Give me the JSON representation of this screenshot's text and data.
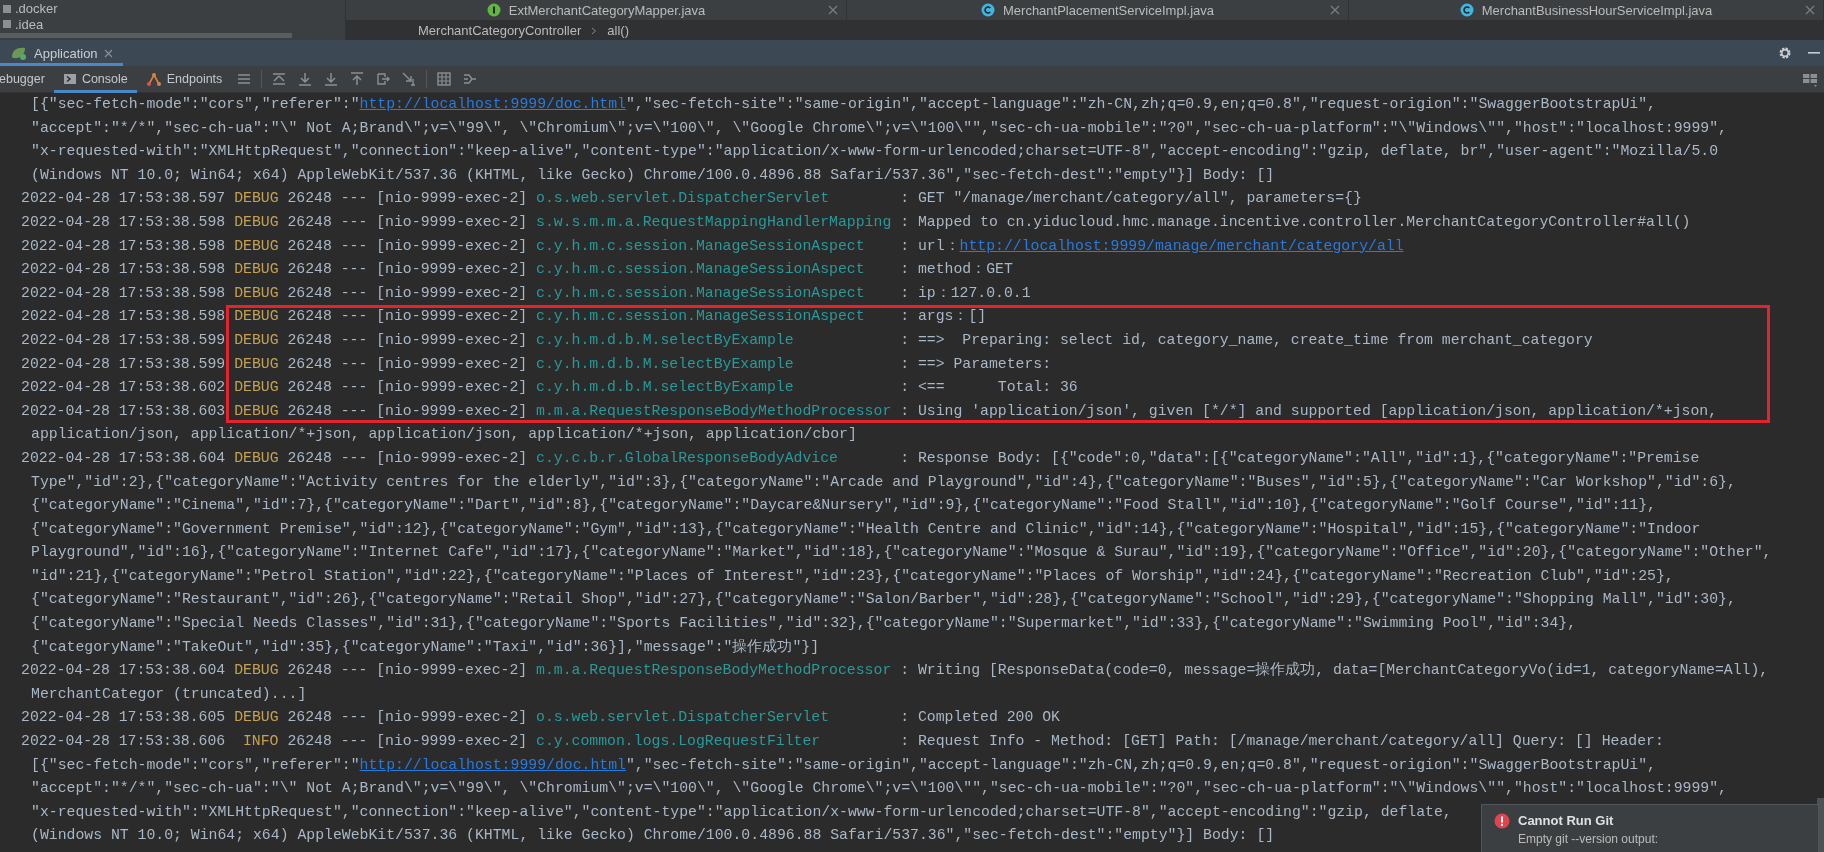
{
  "project_tree": {
    "items": [
      {
        "label": ".docker"
      },
      {
        "label": ".idea"
      }
    ]
  },
  "editor_tabs": [
    {
      "label": "ExtMerchantCategoryMapper.java",
      "kind": "interface"
    },
    {
      "label": "MerchantPlacementServiceImpl.java",
      "kind": "class"
    },
    {
      "label": "MerchantBusinessHourServiceImpl.java",
      "kind": "class"
    }
  ],
  "breadcrumbs": [
    "MerchantCategoryController",
    "all()"
  ],
  "run_window": {
    "tabs": [
      {
        "label": "Application",
        "selected": true
      }
    ]
  },
  "toolbar_tabs": [
    {
      "label": "ebugger",
      "kind": "plain",
      "selected": false
    },
    {
      "label": "Console",
      "kind": "console",
      "selected": true
    },
    {
      "label": "Endpoints",
      "kind": "endpoints",
      "selected": false
    }
  ],
  "console": {
    "lines": [
      {
        "kind": "wrap",
        "text": "[{\"sec-fetch-mode\":\"cors\",\"referer\":\"",
        "link": "http://localhost:9999/doc.html",
        "after": "\",\"sec-fetch-site\":\"same-origin\",\"accept-language\":\"zh-CN,zh;q=0.9,en;q=0.8\",\"request-origion\":\"SwaggerBootstrapUi\","
      },
      {
        "kind": "wrap",
        "text": "\"accept\":\"*/*\",\"sec-ch-ua\":\"\\\" Not A;Brand\\\";v=\\\"99\\\", \\\"Chromium\\\";v=\\\"100\\\", \\\"Google Chrome\\\";v=\\\"100\\\"\",\"sec-ch-ua-mobile\":\"?0\",\"sec-ch-ua-platform\":\"\\\"Windows\\\"\",\"host\":\"localhost:9999\","
      },
      {
        "kind": "wrap",
        "text": "\"x-requested-with\":\"XMLHttpRequest\",\"connection\":\"keep-alive\",\"content-type\":\"application/x-www-form-urlencoded;charset=UTF-8\",\"accept-encoding\":\"gzip, deflate, br\",\"user-agent\":\"Mozilla/5.0"
      },
      {
        "kind": "wrap",
        "text": "(Windows NT 10.0; Win64; x64) AppleWebKit/537.36 (KHTML, like Gecko) Chrome/100.0.4896.88 Safari/537.36\",\"sec-fetch-dest\":\"empty\"}] Body: []"
      },
      {
        "kind": "log",
        "time": "2022-04-28 17:53:38.597",
        "level": "DEBUG",
        "pid": "26248",
        "separator": "---",
        "thread": "[nio-9999-exec-2]",
        "logger": "o.s.web.servlet.DispatcherServlet",
        "message": ": GET \"/manage/merchant/category/all\", parameters={}"
      },
      {
        "kind": "log",
        "time": "2022-04-28 17:53:38.598",
        "level": "DEBUG",
        "pid": "26248",
        "separator": "---",
        "thread": "[nio-9999-exec-2]",
        "logger": "s.w.s.m.m.a.RequestMappingHandlerMapping",
        "message": ": Mapped to cn.yiducloud.hmc.manage.incentive.controller.MerchantCategoryController#all()"
      },
      {
        "kind": "log",
        "time": "2022-04-28 17:53:38.598",
        "level": "DEBUG",
        "pid": "26248",
        "separator": "---",
        "thread": "[nio-9999-exec-2]",
        "logger": "c.y.h.m.c.session.ManageSessionAspect",
        "message": ": url：",
        "link": "http://localhost:9999/manage/merchant/category/all"
      },
      {
        "kind": "log",
        "time": "2022-04-28 17:53:38.598",
        "level": "DEBUG",
        "pid": "26248",
        "separator": "---",
        "thread": "[nio-9999-exec-2]",
        "logger": "c.y.h.m.c.session.ManageSessionAspect",
        "message": ": method：GET"
      },
      {
        "kind": "log",
        "time": "2022-04-28 17:53:38.598",
        "level": "DEBUG",
        "pid": "26248",
        "separator": "---",
        "thread": "[nio-9999-exec-2]",
        "logger": "c.y.h.m.c.session.ManageSessionAspect",
        "message": ": ip：127.0.0.1"
      },
      {
        "kind": "log",
        "time": "2022-04-28 17:53:38.598",
        "level": "DEBUG",
        "pid": "26248",
        "separator": "---",
        "thread": "[nio-9999-exec-2]",
        "logger": "c.y.h.m.c.session.ManageSessionAspect",
        "message": ": args：[]"
      },
      {
        "kind": "log",
        "time": "2022-04-28 17:53:38.599",
        "level": "DEBUG",
        "pid": "26248",
        "separator": "---",
        "thread": "[nio-9999-exec-2]",
        "logger": "c.y.h.m.d.b.M.selectByExample",
        "message": ": ==>  Preparing: select id, category_name, create_time from merchant_category"
      },
      {
        "kind": "log",
        "time": "2022-04-28 17:53:38.599",
        "level": "DEBUG",
        "pid": "26248",
        "separator": "---",
        "thread": "[nio-9999-exec-2]",
        "logger": "c.y.h.m.d.b.M.selectByExample",
        "message": ": ==> Parameters: "
      },
      {
        "kind": "log",
        "time": "2022-04-28 17:53:38.602",
        "level": "DEBUG",
        "pid": "26248",
        "separator": "---",
        "thread": "[nio-9999-exec-2]",
        "logger": "c.y.h.m.d.b.M.selectByExample",
        "message": ": <==      Total: 36"
      },
      {
        "kind": "log",
        "time": "2022-04-28 17:53:38.603",
        "level": "DEBUG",
        "pid": "26248",
        "separator": "---",
        "thread": "[nio-9999-exec-2]",
        "logger": "m.m.a.RequestResponseBodyMethodProcessor",
        "message": ": Using 'application/json', given [*/*] and supported [application/json, application/*+json,"
      },
      {
        "kind": "wrap",
        "text": "application/json, application/*+json, application/json, application/*+json, application/cbor]"
      },
      {
        "kind": "log",
        "time": "2022-04-28 17:53:38.604",
        "level": "DEBUG",
        "pid": "26248",
        "separator": "---",
        "thread": "[nio-9999-exec-2]",
        "logger": "c.y.c.b.r.GlobalResponseBodyAdvice",
        "message": ": Response Body: [{\"code\":0,\"data\":[{\"categoryName\":\"All\",\"id\":1},{\"categoryName\":\"Premise"
      },
      {
        "kind": "wrap",
        "text": "Type\",\"id\":2},{\"categoryName\":\"Activity centres for the elderly\",\"id\":3},{\"categoryName\":\"Arcade and Playground\",\"id\":4},{\"categoryName\":\"Buses\",\"id\":5},{\"categoryName\":\"Car Workshop\",\"id\":6},"
      },
      {
        "kind": "wrap",
        "text": "{\"categoryName\":\"Cinema\",\"id\":7},{\"categoryName\":\"Dart\",\"id\":8},{\"categoryName\":\"Daycare&Nursery\",\"id\":9},{\"categoryName\":\"Food Stall\",\"id\":10},{\"categoryName\":\"Golf Course\",\"id\":11},"
      },
      {
        "kind": "wrap",
        "text": "{\"categoryName\":\"Government Premise\",\"id\":12},{\"categoryName\":\"Gym\",\"id\":13},{\"categoryName\":\"Health Centre and Clinic\",\"id\":14},{\"categoryName\":\"Hospital\",\"id\":15},{\"categoryName\":\"Indoor"
      },
      {
        "kind": "wrap",
        "text": "Playground\",\"id\":16},{\"categoryName\":\"Internet Cafe\",\"id\":17},{\"categoryName\":\"Market\",\"id\":18},{\"categoryName\":\"Mosque & Surau\",\"id\":19},{\"categoryName\":\"Office\",\"id\":20},{\"categoryName\":\"Other\","
      },
      {
        "kind": "wrap",
        "text": "\"id\":21},{\"categoryName\":\"Petrol Station\",\"id\":22},{\"categoryName\":\"Places of Interest\",\"id\":23},{\"categoryName\":\"Places of Worship\",\"id\":24},{\"categoryName\":\"Recreation Club\",\"id\":25},"
      },
      {
        "kind": "wrap",
        "text": "{\"categoryName\":\"Restaurant\",\"id\":26},{\"categoryName\":\"Retail Shop\",\"id\":27},{\"categoryName\":\"Salon/Barber\",\"id\":28},{\"categoryName\":\"School\",\"id\":29},{\"categoryName\":\"Shopping Mall\",\"id\":30},"
      },
      {
        "kind": "wrap",
        "text": "{\"categoryName\":\"Special Needs Classes\",\"id\":31},{\"categoryName\":\"Sports Facilities\",\"id\":32},{\"categoryName\":\"Supermarket\",\"id\":33},{\"categoryName\":\"Swimming Pool\",\"id\":34},"
      },
      {
        "kind": "wrap",
        "text": "{\"categoryName\":\"TakeOut\",\"id\":35},{\"categoryName\":\"Taxi\",\"id\":36}],\"message\":\"操作成功\"}]"
      },
      {
        "kind": "log",
        "time": "2022-04-28 17:53:38.604",
        "level": "DEBUG",
        "pid": "26248",
        "separator": "---",
        "thread": "[nio-9999-exec-2]",
        "logger": "m.m.a.RequestResponseBodyMethodProcessor",
        "message": ": Writing [ResponseData(code=0, message=操作成功, data=[MerchantCategoryVo(id=1, categoryName=All),"
      },
      {
        "kind": "wrap",
        "text": "MerchantCategor (truncated)...]"
      },
      {
        "kind": "log",
        "time": "2022-04-28 17:53:38.605",
        "level": "DEBUG",
        "pid": "26248",
        "separator": "---",
        "thread": "[nio-9999-exec-2]",
        "logger": "o.s.web.servlet.DispatcherServlet",
        "message": ": Completed 200 OK"
      },
      {
        "kind": "log",
        "time": "2022-04-28 17:53:38.606",
        "level": "INFO",
        "pid": "26248",
        "separator": "---",
        "thread": "[nio-9999-exec-2]",
        "logger": "c.y.common.logs.LogRequestFilter",
        "message": ": Request Info - Method: [GET] Path: [/manage/merchant/category/all] Query: [] Header: "
      },
      {
        "kind": "wrap",
        "text": "[{\"sec-fetch-mode\":\"cors\",\"referer\":\"",
        "link": "http://localhost:9999/doc.html",
        "after": "\",\"sec-fetch-site\":\"same-origin\",\"accept-language\":\"zh-CN,zh;q=0.9,en;q=0.8\",\"request-origion\":\"SwaggerBootstrapUi\","
      },
      {
        "kind": "wrap",
        "text": "\"accept\":\"*/*\",\"sec-ch-ua\":\"\\\" Not A;Brand\\\";v=\\\"99\\\", \\\"Chromium\\\";v=\\\"100\\\", \\\"Google Chrome\\\";v=\\\"100\\\"\",\"sec-ch-ua-mobile\":\"?0\",\"sec-ch-ua-platform\":\"\\\"Windows\\\"\",\"host\":\"localhost:9999\","
      },
      {
        "kind": "wrap",
        "text": "\"x-requested-with\":\"XMLHttpRequest\",\"connection\":\"keep-alive\",\"content-type\":\"application/x-www-form-urlencoded;charset=UTF-8\",\"accept-encoding\":\"gzip, deflate,"
      },
      {
        "kind": "wrap",
        "text": "(Windows NT 10.0; Win64; x64) AppleWebKit/537.36 (KHTML, like Gecko) Chrome/100.0.4896.88 Safari/537.36\",\"sec-fetch-dest\":\"empty\"}] Body: []"
      }
    ]
  },
  "notification": {
    "kind": "error",
    "title": "Cannot Run Git",
    "text": "Empty git --version output:"
  }
}
